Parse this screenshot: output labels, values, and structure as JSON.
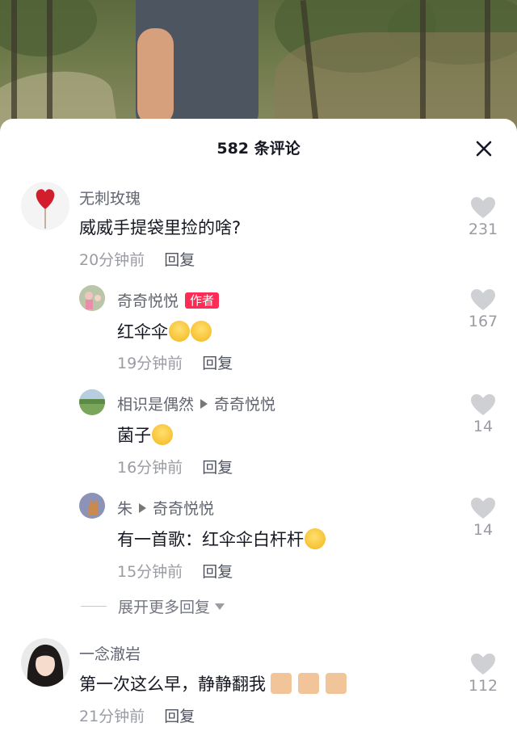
{
  "header": {
    "title": "582 条评论"
  },
  "reply_label": "回复",
  "expand_more_label": "展开更多回复",
  "colors": {
    "author_badge": "#fe2c55",
    "text": "#161823",
    "meta": "#9a9ca3",
    "username": "#616570"
  },
  "comments": [
    {
      "username": "无刺玫瑰",
      "text": "威威手提袋里捡的啥?",
      "time": "20分钟前",
      "likes": "231"
    },
    {
      "username": "奇奇悦悦",
      "badge": "作者",
      "text": "红伞伞",
      "time": "19分钟前",
      "likes": "167"
    },
    {
      "username": "相识是偶然",
      "reply_to": "奇奇悦悦",
      "text": "菌子",
      "time": "16分钟前",
      "likes": "14"
    },
    {
      "username": "朱",
      "reply_to": "奇奇悦悦",
      "text": "有一首歌：红伞伞白杆杆",
      "time": "15分钟前",
      "likes": "14"
    },
    {
      "username": "一念澈岩",
      "text": "第一次这么早，静静翻我",
      "time": "21分钟前",
      "likes": "112"
    }
  ]
}
